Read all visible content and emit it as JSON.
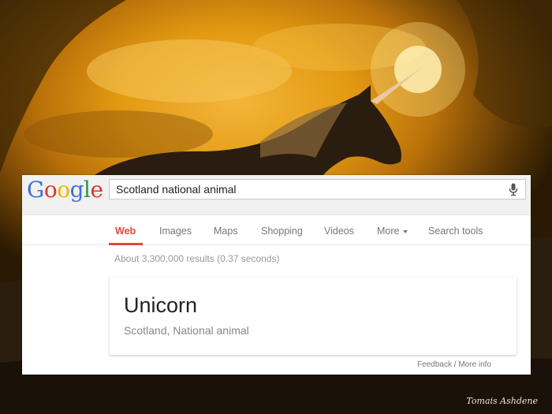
{
  "background": {
    "watermark": "Tomais Ashdene"
  },
  "google": {
    "logo_letters": [
      {
        "char": "G",
        "color": "#3f6fd8"
      },
      {
        "char": "o",
        "color": "#d8382a"
      },
      {
        "char": "o",
        "color": "#f0b400"
      },
      {
        "char": "g",
        "color": "#3f6fd8"
      },
      {
        "char": "l",
        "color": "#2a9b48"
      },
      {
        "char": "e",
        "color": "#d8382a"
      }
    ],
    "search_query": "Scotland national animal",
    "mic_icon": "microphone-icon"
  },
  "tabs": [
    {
      "label": "Web",
      "active": true
    },
    {
      "label": "Images"
    },
    {
      "label": "Maps"
    },
    {
      "label": "Shopping"
    },
    {
      "label": "Videos"
    },
    {
      "label": "More"
    },
    {
      "label": "Search tools"
    }
  ],
  "results": {
    "stats": "About 3,300,000 results (0.37 seconds)",
    "answer_title": "Unicorn",
    "answer_subtitle": "Scotland, National animal",
    "feedback_link": "Feedback / More info"
  },
  "colors": {
    "accent_red": "#dd4b39"
  }
}
